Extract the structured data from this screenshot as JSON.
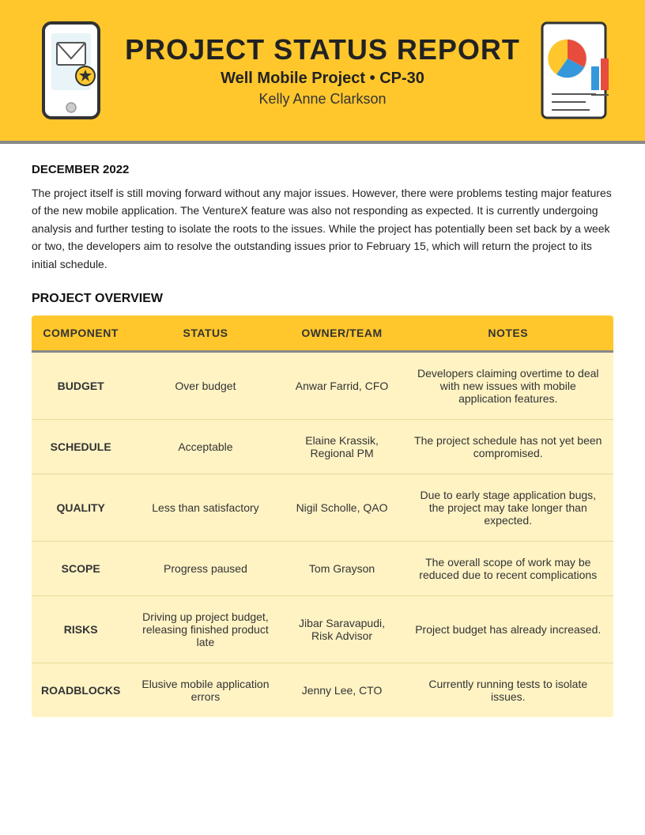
{
  "header": {
    "title": "PROJECT STATUS REPORT",
    "subtitle": "Well Mobile Project • CP-30",
    "name": "Kelly Anne Clarkson"
  },
  "date_label": "DECEMBER 2022",
  "intro": "The project itself is still moving forward without any major issues. However, there were problems testing major features of the new mobile application. The VentureX feature was also not responding as expected. It is currently undergoing analysis and further testing to isolate the roots to the issues. While the project has potentially been set back by a week or two, the developers aim to resolve the outstanding issues prior to February 15, which will return the project to its initial schedule.",
  "section_title": "PROJECT OVERVIEW",
  "table": {
    "columns": [
      "COMPONENT",
      "STATUS",
      "OWNER/TEAM",
      "NOTES"
    ],
    "rows": [
      {
        "component": "BUDGET",
        "status": "Over budget",
        "owner": "Anwar Farrid, CFO",
        "notes": "Developers claiming overtime to deal with new issues with mobile application features."
      },
      {
        "component": "SCHEDULE",
        "status": "Acceptable",
        "owner": "Elaine Krassik, Regional PM",
        "notes": "The project schedule has not yet been compromised."
      },
      {
        "component": "QUALITY",
        "status": "Less than satisfactory",
        "owner": "Nigil Scholle, QAO",
        "notes": "Due to early stage application bugs, the project may take longer than expected."
      },
      {
        "component": "SCOPE",
        "status": "Progress paused",
        "owner": "Tom Grayson",
        "notes": "The overall scope of work may be reduced due to recent complications"
      },
      {
        "component": "RISKS",
        "status": "Driving up project budget, releasing finished product late",
        "owner": "Jibar Saravapudi, Risk Advisor",
        "notes": "Project budget has already increased."
      },
      {
        "component": "ROADBLOCKS",
        "status": "Elusive mobile application errors",
        "owner": "Jenny Lee, CTO",
        "notes": "Currently running tests to isolate issues."
      }
    ]
  }
}
